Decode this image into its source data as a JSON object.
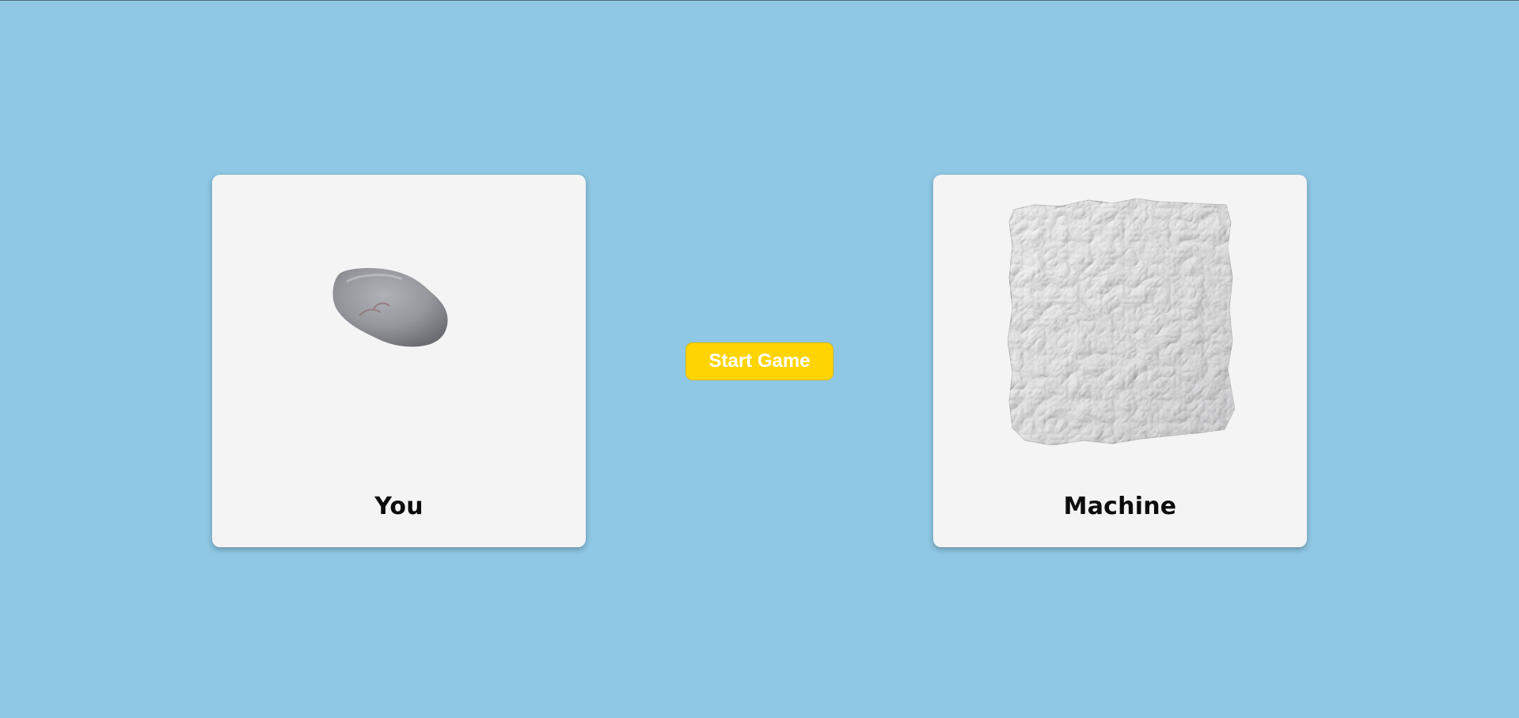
{
  "player": {
    "label": "You",
    "choice": "rock",
    "choice_icon": "rock-icon"
  },
  "machine": {
    "label": "Machine",
    "choice": "paper",
    "choice_icon": "paper-icon"
  },
  "controls": {
    "start_label": "Start Game"
  },
  "colors": {
    "background": "#8fc8e5",
    "card": "#f5f4f4",
    "button": "#ffd400",
    "button_text": "#ffffff"
  }
}
